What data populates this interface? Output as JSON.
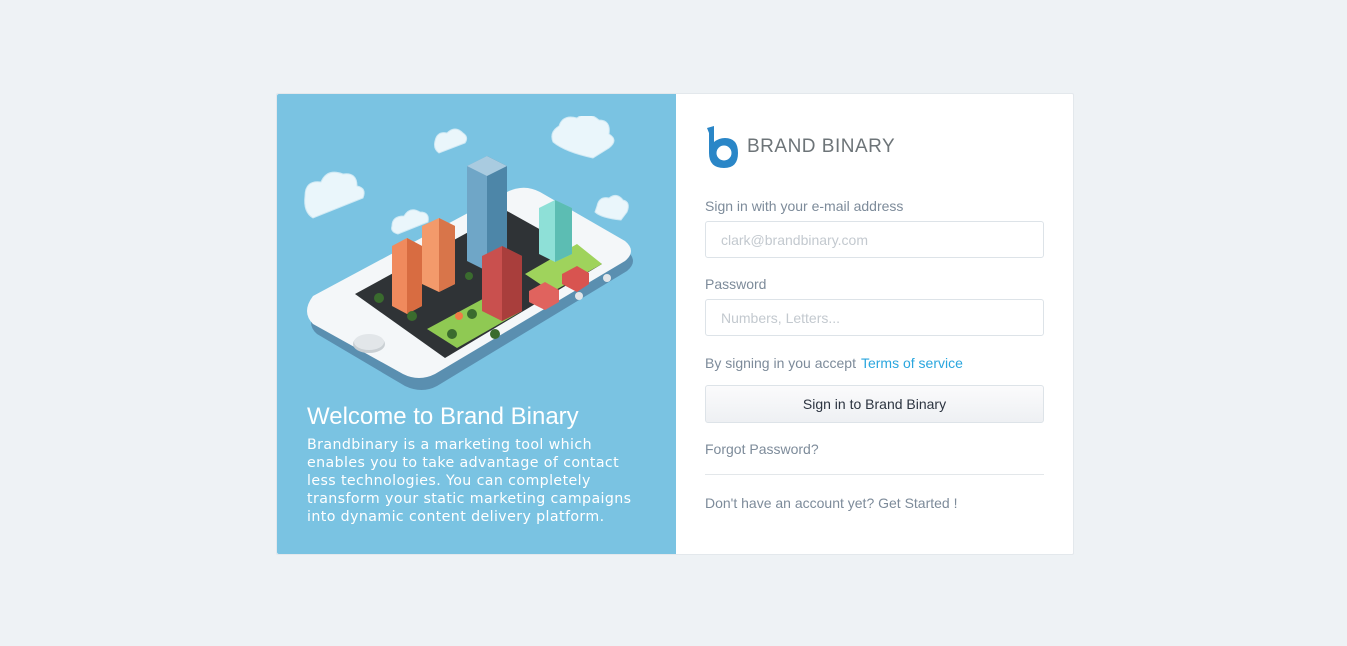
{
  "welcome": {
    "title": "Welcome to Brand Binary",
    "text": "Brandbinary is a marketing tool which enables you to take advantage of contact less technologies. You can completely transform your static marketing campaigns into dynamic content delivery platform."
  },
  "logo": {
    "text": "BRAND BINARY",
    "icon": "brand-b-logo-icon"
  },
  "form": {
    "email_label": "Sign in with your e-mail address",
    "email_placeholder": "clark@brandbinary.com",
    "email_value": "",
    "password_label": "Password",
    "password_placeholder": "Numbers, Letters...",
    "password_value": "",
    "accept_text": "By signing in you accept",
    "terms_link": "Terms of service",
    "signin_button": "Sign in to Brand Binary",
    "forgot_link": "Forgot Password?",
    "signup_link": "Don't have an account yet? Get Started !"
  },
  "colors": {
    "left_panel": "#7ac3e2",
    "link": "#2aa6de",
    "background": "#eef2f5"
  }
}
